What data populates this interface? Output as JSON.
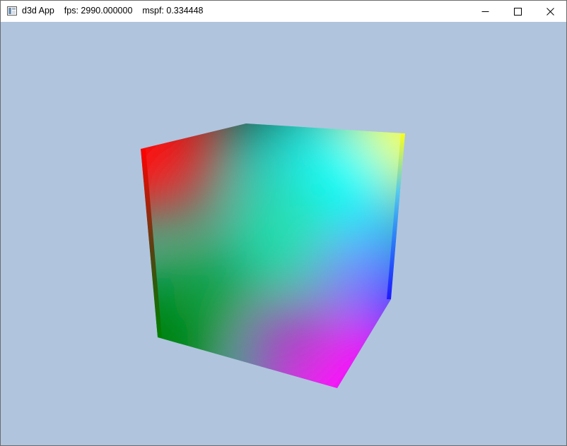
{
  "window": {
    "app_name": "d3d App",
    "fps_label": "fps: 2990.000000",
    "mspf_label": "mspf: 0.334448",
    "minimize_glyph": "—",
    "maximize_glyph": "☐",
    "close_glyph": "✕"
  },
  "viewport": {
    "clear_color": "#b0c4de",
    "object": "vertex-colored cube",
    "corner_colors": {
      "top_left": "#ff0000",
      "top_back": "#000000",
      "top_right": "#ffff00",
      "center": "#00ffff",
      "bottom_left": "#008000",
      "right_mid": "#0000ff",
      "bottom": "#ff00ff"
    }
  }
}
